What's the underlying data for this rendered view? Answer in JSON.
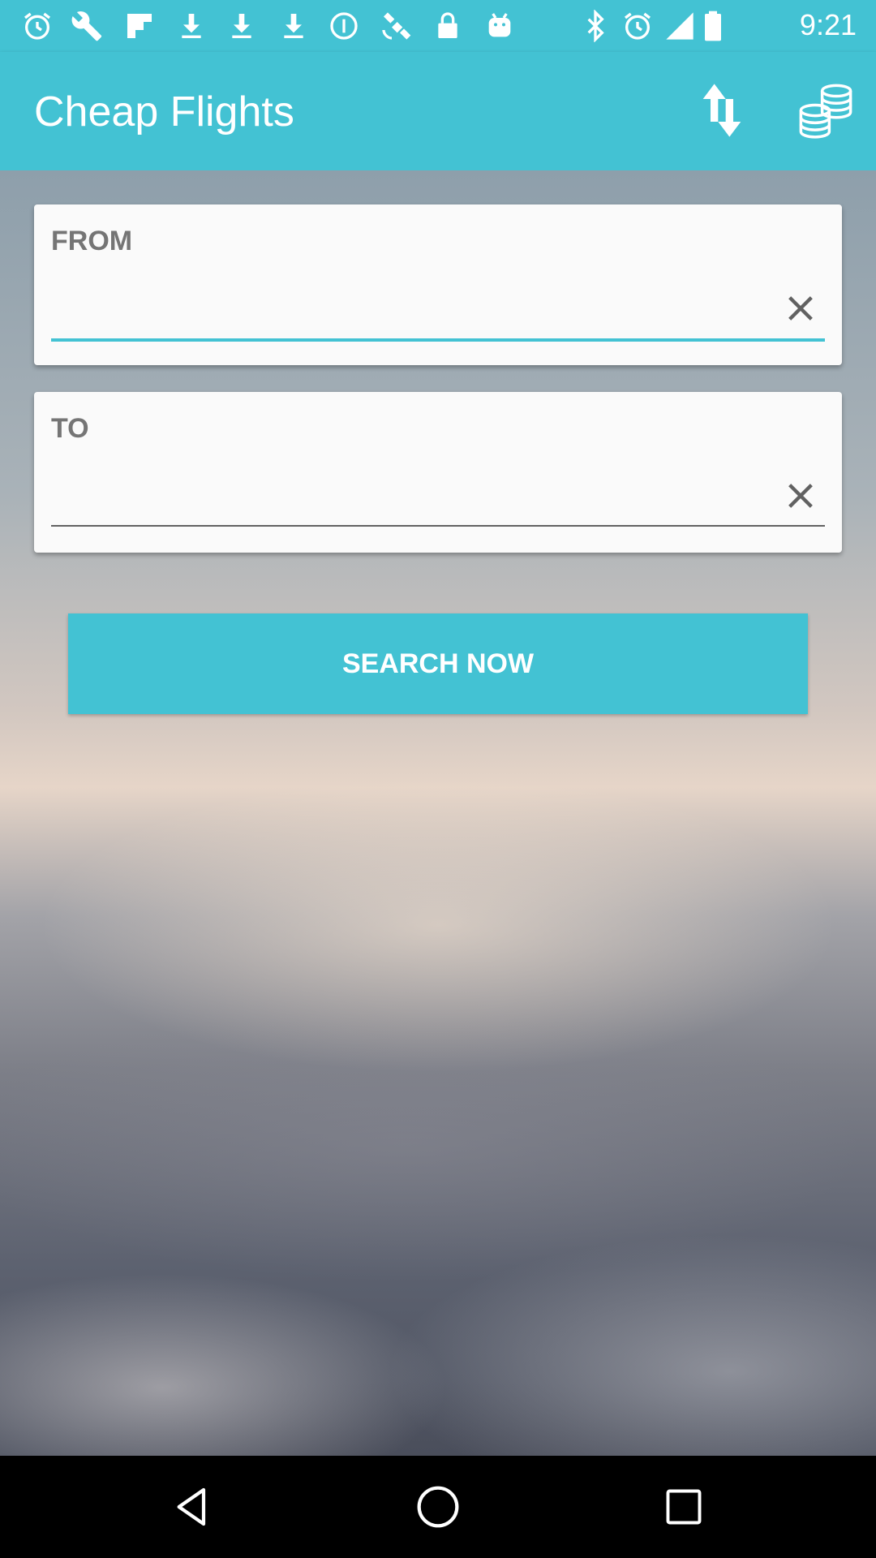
{
  "status_bar": {
    "time": "9:21",
    "icons": [
      "alarm-icon",
      "wrench-icon",
      "flipboard-icon",
      "download-icon",
      "download-icon",
      "download-icon",
      "data-saver-icon",
      "satellite-icon",
      "lock-icon",
      "android-icon",
      "bluetooth-icon",
      "alarm-icon",
      "cellular-signal-icon",
      "battery-icon"
    ]
  },
  "app_bar": {
    "title": "Cheap Flights",
    "actions": [
      "swap-vertical-icon",
      "coins-icon"
    ]
  },
  "from_card": {
    "label": "FROM",
    "value": "",
    "clear_icon": "close-icon",
    "underline_color": "#43c2d3"
  },
  "to_card": {
    "label": "TO",
    "value": "",
    "clear_icon": "close-icon",
    "underline_color": "#616161"
  },
  "search_button": {
    "label": "SEARCH NOW"
  },
  "nav_bar": {
    "buttons": [
      "back-icon",
      "home-icon",
      "recents-icon"
    ]
  },
  "colors": {
    "accent": "#43c2d3",
    "card_background": "#fafafa",
    "label_text": "#757575"
  }
}
